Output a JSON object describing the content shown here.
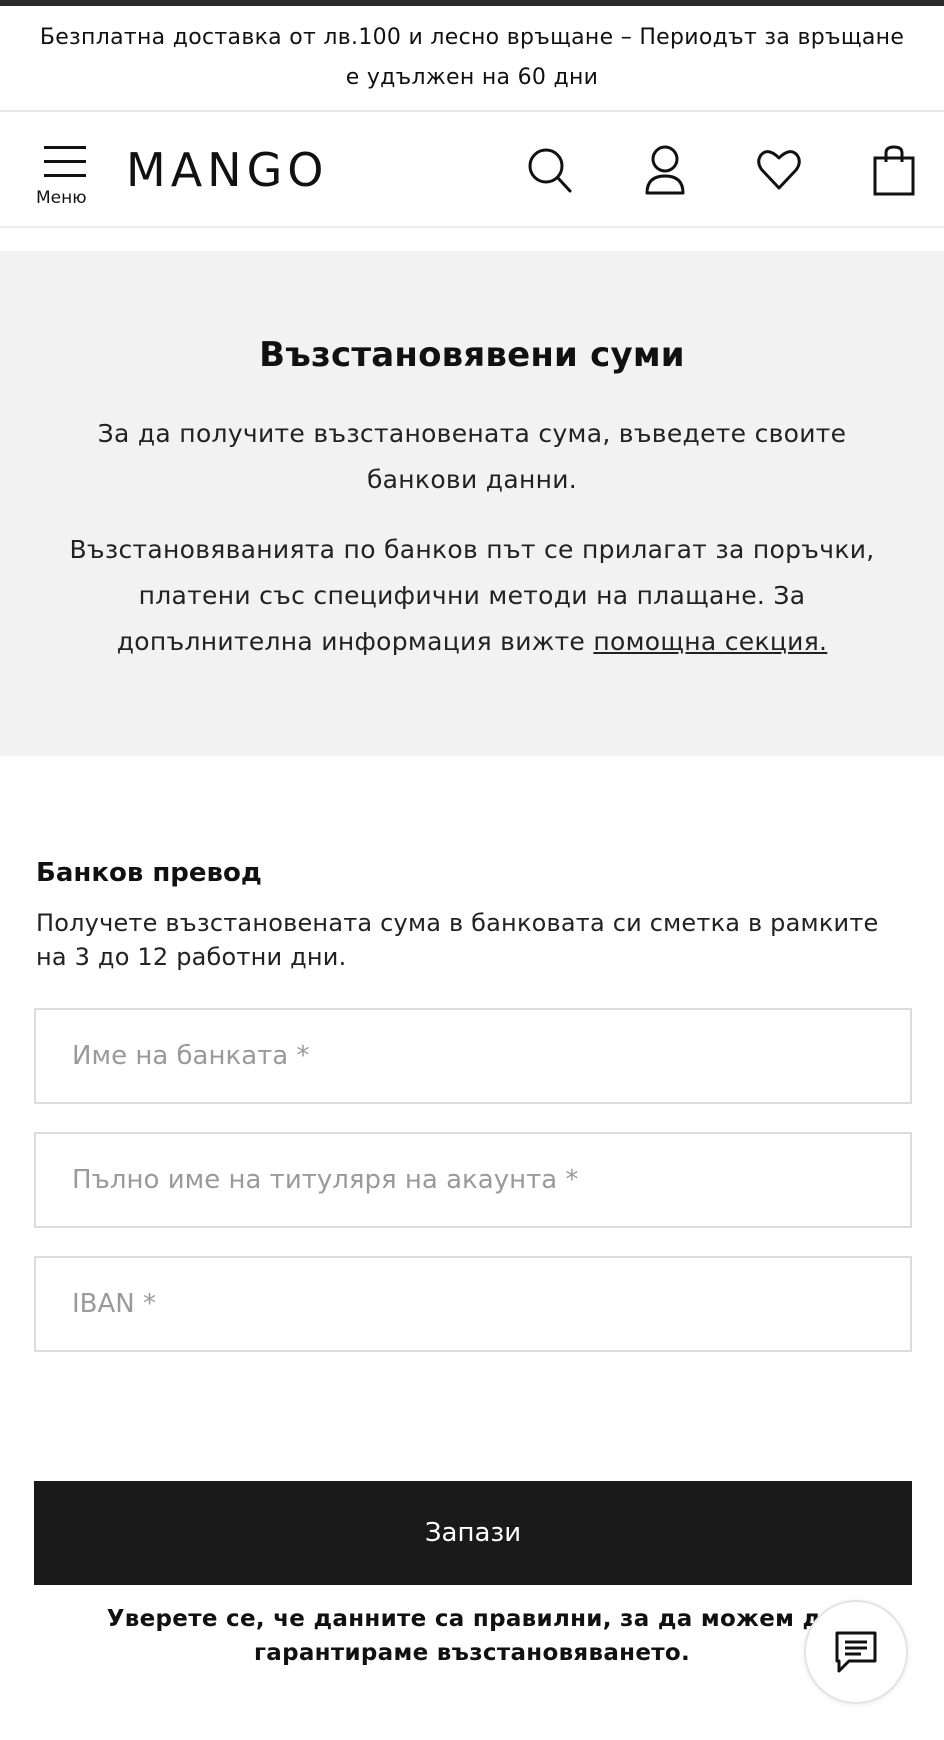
{
  "promo": {
    "text": "Безплатна доставка от лв.100 и лесно връщане – Периодът за връщане е удължен на 60 дни"
  },
  "header": {
    "menu_label": "Меню",
    "logo": "MANGO",
    "icons": [
      "search-icon",
      "user-icon",
      "heart-icon",
      "bag-icon"
    ]
  },
  "hero": {
    "title": "Възстановявени суми",
    "paragraph1": "За да получите възстановената сума, въведете своите банкови данни.",
    "paragraph2_text": "Възстановяванията по банков път се прилагат за поръчки, платени със специфични методи на плащане. За допълнителна информация вижте ",
    "help_link": "помощна секция."
  },
  "bank_transfer": {
    "title": "Банков превод",
    "description": "Получете възстановената сума в банковата си сметка в рамките на 3 до 12 работни дни.",
    "fields": {
      "bank_name_placeholder": "Име на банката *",
      "holder_name_placeholder": "Пълно име на титуляря на акаунта *",
      "iban_placeholder": "IBAN *"
    },
    "save_label": "Запази",
    "note": "Уверете се, че данните са правилни, за да можем да гарантираме възстановяването."
  },
  "colors": {
    "hero_bg": "#f2f2f2",
    "button_bg": "#1a1a1a",
    "text": "#111111"
  }
}
